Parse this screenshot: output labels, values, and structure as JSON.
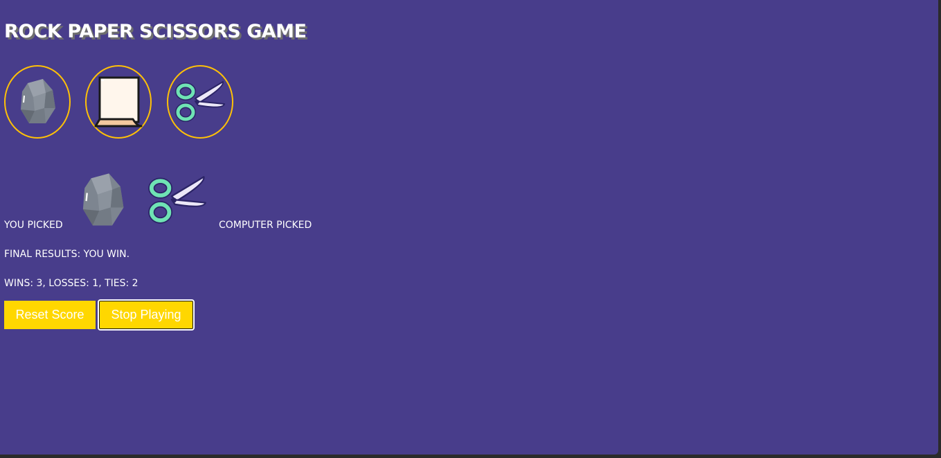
{
  "header": {
    "title": "ROCK PAPER SCISSORS GAME"
  },
  "choices": [
    {
      "name": "rock",
      "icon": "rock-icon"
    },
    {
      "name": "paper",
      "icon": "paper-icon"
    },
    {
      "name": "scissors",
      "icon": "scissors-icon"
    }
  ],
  "round": {
    "you_picked_label": "YOU PICKED",
    "player_choice_icon": "rock-icon",
    "computer_choice_icon": "scissors-icon",
    "computer_picked_label": "COMPUTER PICKED",
    "result_text": "FINAL RESULTS: YOU WIN.",
    "score_text": "WINS: 3, LOSSES: 1, TIES: 2"
  },
  "actions": {
    "reset_label": "Reset Score",
    "stop_label": "Stop Playing"
  },
  "colors": {
    "background": "#483d8b",
    "accent": "#ffd700",
    "choice_ring": "#ffc107"
  }
}
